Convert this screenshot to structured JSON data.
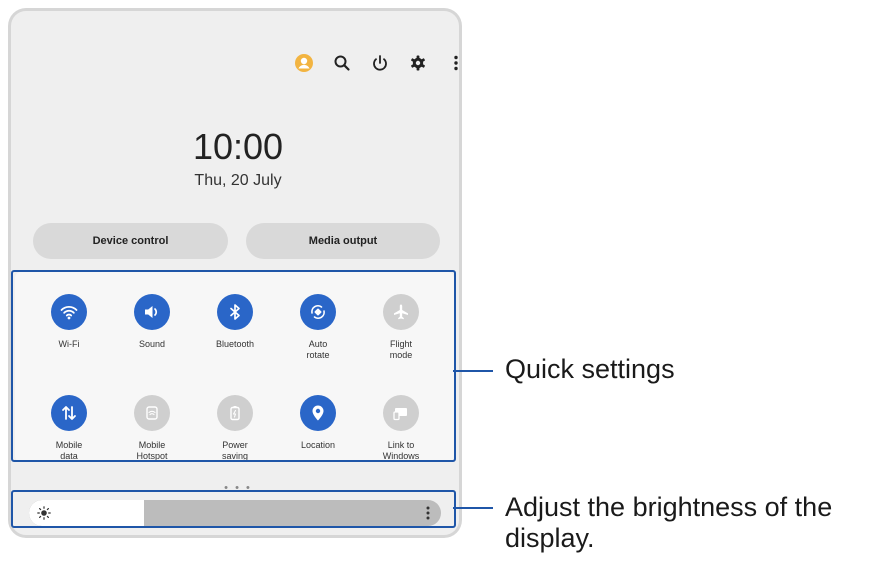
{
  "header": {
    "icons": [
      "account-icon",
      "search-icon",
      "power-icon",
      "gear-icon",
      "more-vert-icon"
    ]
  },
  "clock": {
    "time": "10:00",
    "date": "Thu, 20 July"
  },
  "buttons": {
    "device_control": "Device control",
    "media_output": "Media output"
  },
  "quick_settings": {
    "tiles": [
      {
        "label": "Wi-Fi",
        "icon": "wifi-icon",
        "on": true
      },
      {
        "label": "Sound",
        "icon": "sound-icon",
        "on": true
      },
      {
        "label": "Bluetooth",
        "icon": "bluetooth-icon",
        "on": true
      },
      {
        "label": "Auto\nrotate",
        "icon": "auto-rotate-icon",
        "on": true
      },
      {
        "label": "Flight\nmode",
        "icon": "airplane-icon",
        "on": false
      },
      {
        "label": "Mobile\ndata",
        "icon": "mobile-data-icon",
        "on": true
      },
      {
        "label": "Mobile\nHotspot",
        "icon": "hotspot-icon",
        "on": false
      },
      {
        "label": "Power\nsaving",
        "icon": "power-saving-icon",
        "on": false
      },
      {
        "label": "Location",
        "icon": "location-icon",
        "on": true
      },
      {
        "label": "Link to\nWindows",
        "icon": "link-to-windows-icon",
        "on": false
      }
    ]
  },
  "pager": {
    "dots": "• • •"
  },
  "brightness": {
    "level": 0.28
  },
  "annotations": {
    "quick_settings": "Quick settings",
    "brightness": "Adjust the brightness of the display."
  },
  "colors": {
    "accent": "#2a66c8",
    "highlight": "#1f56a8",
    "tile_off": "#cfcfcf"
  }
}
